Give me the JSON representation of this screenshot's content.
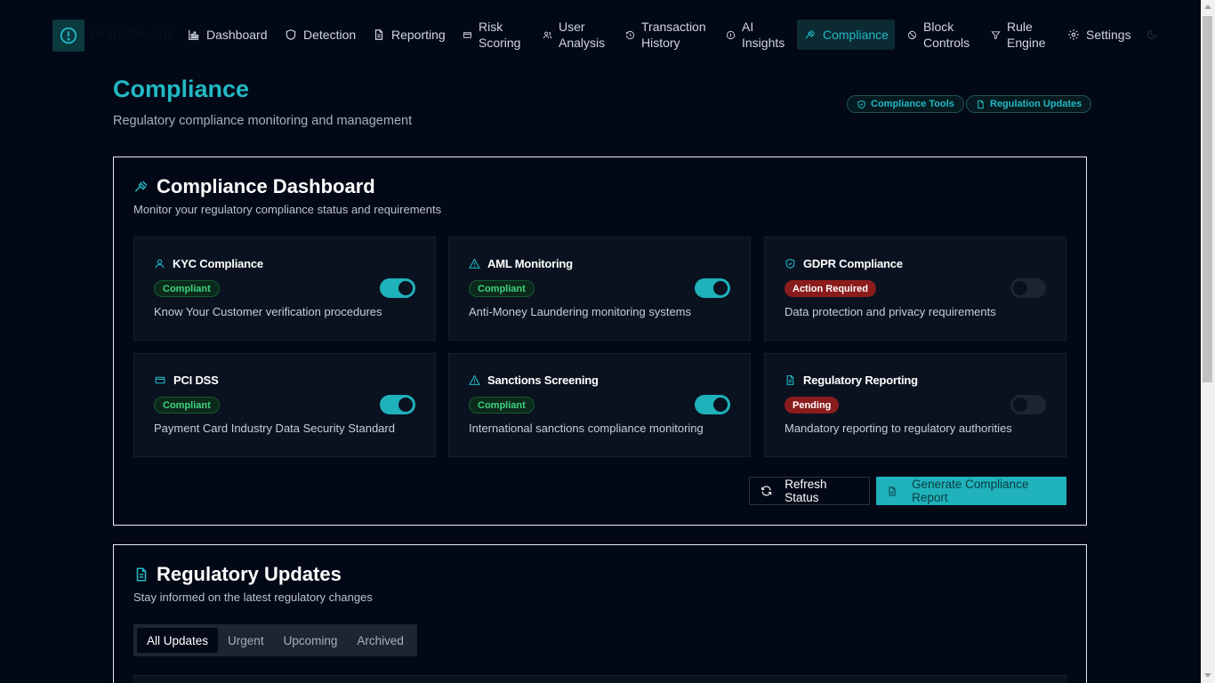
{
  "app": {
    "logo_text": "FraudGuard"
  },
  "nav": [
    {
      "label": "Dashboard",
      "icon": "bar-chart-icon"
    },
    {
      "label": "Detection",
      "icon": "shield-icon"
    },
    {
      "label": "Reporting",
      "icon": "file-text-icon"
    },
    {
      "label": "Risk Scoring",
      "icon": "credit-card-icon"
    },
    {
      "label": "User Analysis",
      "icon": "users-icon"
    },
    {
      "label": "Transaction History",
      "icon": "history-icon"
    },
    {
      "label": "AI Insights",
      "icon": "info-circle-icon"
    },
    {
      "label": "Compliance",
      "icon": "gavel-icon",
      "active": true
    },
    {
      "label": "Block Controls",
      "icon": "ban-icon"
    },
    {
      "label": "Rule Engine",
      "icon": "filter-icon"
    },
    {
      "label": "Settings",
      "icon": "gear-icon"
    }
  ],
  "header": {
    "title": "Compliance",
    "subtitle": "Regulatory compliance monitoring and management",
    "compliance_tools": "Compliance Tools",
    "regulation_updates": "Regulation Updates"
  },
  "dashboard": {
    "title": "Compliance Dashboard",
    "description": "Monitor your regulatory compliance status and requirements",
    "items": [
      {
        "title": "KYC Compliance",
        "status": "Compliant",
        "description": "Know Your Customer verification procedures",
        "enabled": true,
        "icon": "user-icon"
      },
      {
        "title": "AML Monitoring",
        "status": "Compliant",
        "description": "Anti-Money Laundering monitoring systems",
        "enabled": true,
        "icon": "alert-triangle-icon"
      },
      {
        "title": "GDPR Compliance",
        "status": "Action Required",
        "description": "Data protection and privacy requirements",
        "enabled": false,
        "icon": "shield-check-icon"
      },
      {
        "title": "PCI DSS",
        "status": "Compliant",
        "description": "Payment Card Industry Data Security Standard",
        "enabled": true,
        "icon": "credit-card-icon"
      },
      {
        "title": "Sanctions Screening",
        "status": "Compliant",
        "description": "International sanctions compliance monitoring",
        "enabled": true,
        "icon": "alert-triangle-icon"
      },
      {
        "title": "Regulatory Reporting",
        "status": "Pending",
        "description": "Mandatory reporting to regulatory authorities",
        "enabled": false,
        "icon": "file-text-icon"
      }
    ],
    "refresh_label": "Refresh Status",
    "generate_label": "Generate Compliance Report"
  },
  "updates": {
    "title": "Regulatory Updates",
    "description": "Stay informed on the latest regulatory changes",
    "tabs": [
      "All Updates",
      "Urgent",
      "Upcoming",
      "Archived"
    ],
    "active_tab": "All Updates"
  },
  "colors": {
    "accent": "#22b8c3",
    "background": "#030816",
    "compliant": "#3fd27e",
    "danger": "#8b1c1c"
  }
}
